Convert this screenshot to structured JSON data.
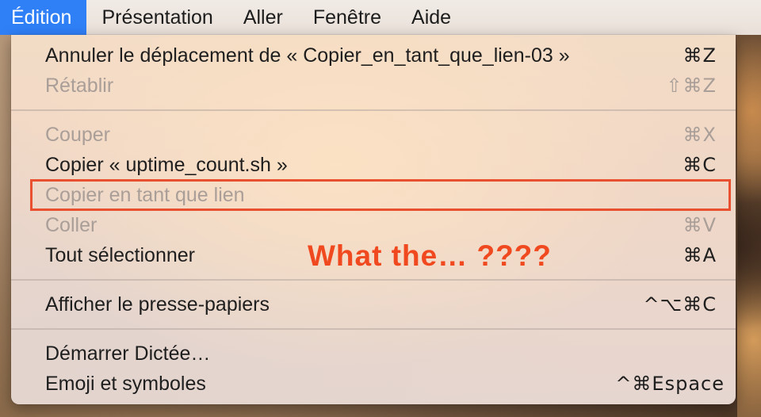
{
  "menubar": {
    "items": [
      {
        "label": "Édition",
        "active": true
      },
      {
        "label": "Présentation",
        "active": false
      },
      {
        "label": "Aller",
        "active": false
      },
      {
        "label": "Fenêtre",
        "active": false
      },
      {
        "label": "Aide",
        "active": false
      }
    ]
  },
  "menu": {
    "items": [
      {
        "label": "Annuler le déplacement de « Copier_en_tant_que_lien-03 »",
        "shortcut": "⌘Z",
        "enabled": true
      },
      {
        "label": "Rétablir",
        "shortcut": "⇧⌘Z",
        "enabled": false
      },
      {
        "label": "Couper",
        "shortcut": "⌘X",
        "enabled": false
      },
      {
        "label": "Copier « uptime_count.sh »",
        "shortcut": "⌘C",
        "enabled": true
      },
      {
        "label": "Copier en tant que lien",
        "shortcut": "",
        "enabled": false
      },
      {
        "label": "Coller",
        "shortcut": "⌘V",
        "enabled": false
      },
      {
        "label": "Tout sélectionner",
        "shortcut": "⌘A",
        "enabled": true
      },
      {
        "label": "Afficher le presse-papiers",
        "shortcut": "^⌥⌘C",
        "enabled": true
      },
      {
        "label": "Démarrer Dictée…",
        "shortcut": "",
        "enabled": true
      },
      {
        "label": "Emoji et symboles",
        "shortcut": "^⌘Espace",
        "enabled": true
      }
    ]
  },
  "annotation": {
    "text": "What the… ????",
    "color": "#f0491f"
  },
  "colors": {
    "accent": "#2f7ff6",
    "highlight_border": "#e8502f",
    "disabled_text": "#a99e98"
  }
}
